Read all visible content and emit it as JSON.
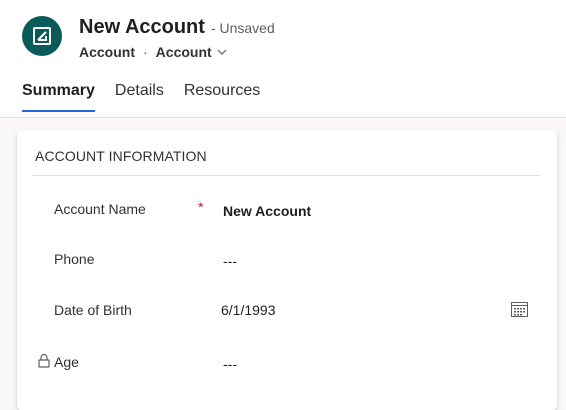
{
  "header": {
    "title": "New Account",
    "status": "- Unsaved",
    "breadcrumb": {
      "entity": "Account",
      "separator": "·",
      "form": "Account"
    },
    "avatar_icon": "account-entity-icon",
    "avatar_color": "#0b5a5a"
  },
  "tabs": [
    {
      "label": "Summary",
      "active": true
    },
    {
      "label": "Details",
      "active": false
    },
    {
      "label": "Resources",
      "active": false
    }
  ],
  "section": {
    "title": "ACCOUNT INFORMATION",
    "fields": [
      {
        "label": "Account Name",
        "required_marker": "*",
        "value": "New Account"
      },
      {
        "label": "Phone",
        "value": "---"
      },
      {
        "label": "Date of Birth",
        "value": "6/1/1993",
        "icon": "calendar-icon"
      },
      {
        "label": "Age",
        "value": "---",
        "icon": "lock-icon"
      }
    ]
  },
  "colors": {
    "accent": "#2266e3",
    "required": "#a4262c",
    "page_background": "#faf9f8"
  }
}
